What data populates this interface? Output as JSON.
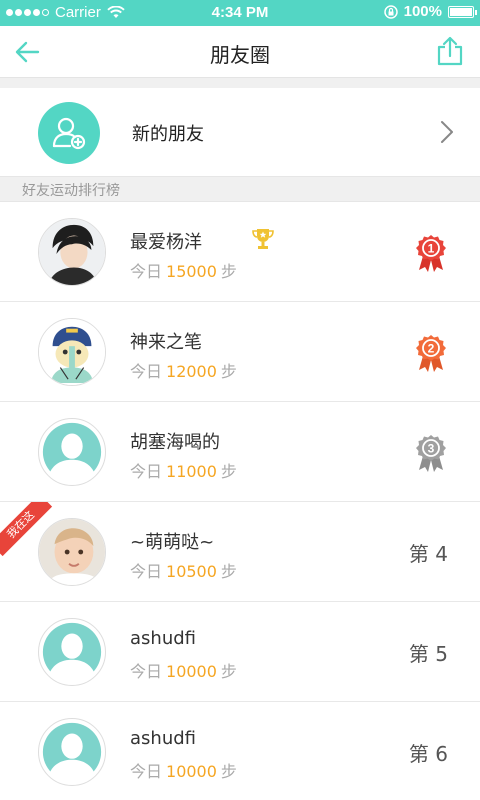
{
  "status": {
    "carrier": "Carrier",
    "time": "4:34 PM",
    "battery": "100%"
  },
  "header": {
    "title": "朋友圈"
  },
  "new_friends": {
    "label": "新的朋友"
  },
  "section": {
    "title": "好友运动排行榜"
  },
  "ranking": [
    {
      "name": "最爱杨洋",
      "steps_prefix": "今日",
      "steps": "15000",
      "steps_suffix": "步",
      "rank_label": "",
      "medal": "1",
      "trophy": true,
      "me": false
    },
    {
      "name": "神来之笔",
      "steps_prefix": "今日",
      "steps": "12000",
      "steps_suffix": "步",
      "rank_label": "",
      "medal": "2",
      "trophy": false,
      "me": false
    },
    {
      "name": "胡塞海喝的",
      "steps_prefix": "今日",
      "steps": "11000",
      "steps_suffix": "步",
      "rank_label": "",
      "medal": "3",
      "trophy": false,
      "me": false
    },
    {
      "name": "~萌萌哒~",
      "steps_prefix": "今日",
      "steps": "10500",
      "steps_suffix": "步",
      "rank_label": "第 4",
      "medal": "",
      "trophy": false,
      "me": true
    },
    {
      "name": "ashudfi",
      "steps_prefix": "今日",
      "steps": "10000",
      "steps_suffix": "步",
      "rank_label": "第 5",
      "medal": "",
      "trophy": false,
      "me": false
    },
    {
      "name": "ashudfi",
      "steps_prefix": "今日",
      "steps": "10000",
      "steps_suffix": "步",
      "rank_label": "第 6",
      "medal": "",
      "trophy": false,
      "me": false
    }
  ],
  "me_ribbon": "我在这",
  "colors": {
    "accent": "#53d6c4",
    "steps": "#f5a623",
    "gold": "#e8443a",
    "silver": "#f26b3a",
    "bronze": "#a0a0a0"
  }
}
